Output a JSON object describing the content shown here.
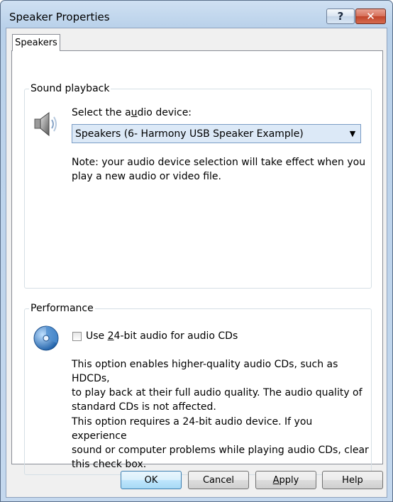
{
  "window": {
    "title": "Speaker Properties",
    "help_glyph": "?",
    "close_glyph": "✕"
  },
  "tabs": [
    {
      "label": "Speakers",
      "selected": true
    }
  ],
  "sound_playback": {
    "legend": "Sound playback",
    "select_label_pre": "Select the a",
    "select_label_mnemonic": "u",
    "select_label_post": "dio device:",
    "device_value": "Speakers (6- Harmony USB Speaker Example)",
    "note_line1": "Note: your audio device selection will take effect when you",
    "note_line2": "play a new audio or video file.",
    "icon": "speaker-icon"
  },
  "performance": {
    "legend": "Performance",
    "checkbox_pre": "Use ",
    "checkbox_mnemonic": "2",
    "checkbox_post": "4-bit audio for audio CDs",
    "checked": false,
    "para1_line1": "This option enables higher-quality audio CDs, such as HDCDs,",
    "para1_line2": "to play back at their full audio quality. The audio quality of",
    "para1_line3": "standard CDs is not affected.",
    "para2_line1": "This option requires a 24-bit audio device. If you experience",
    "para2_line2": "sound or computer problems while playing audio CDs, clear",
    "para2_line3": "this check box.",
    "icon": "audio-cd-icon"
  },
  "buttons": {
    "ok": "OK",
    "cancel": "Cancel",
    "apply_mnemonic": "A",
    "apply_rest": "pply",
    "help": "Help"
  },
  "colors": {
    "accent": "#3c7fb1",
    "titlebar": "#b9d1ea",
    "close": "#c1452b"
  }
}
